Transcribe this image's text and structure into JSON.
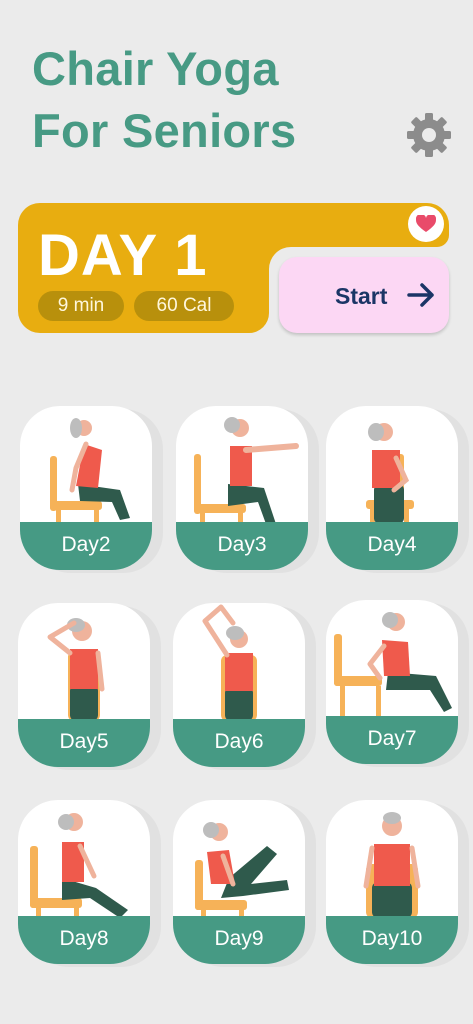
{
  "header": {
    "title_line1": "Chair Yoga",
    "title_line2": "For Seniors"
  },
  "today": {
    "title": "DAY 1",
    "duration": "9 min",
    "calories": "60 Cal",
    "start_label": "Start"
  },
  "days": [
    {
      "label": "Day2"
    },
    {
      "label": "Day3"
    },
    {
      "label": "Day4"
    },
    {
      "label": "Day5"
    },
    {
      "label": "Day6"
    },
    {
      "label": "Day7"
    },
    {
      "label": "Day8"
    },
    {
      "label": "Day9"
    },
    {
      "label": "Day10"
    }
  ],
  "colors": {
    "brand_green": "#479a84",
    "card_yellow": "#e8ad10",
    "pill_dark_yellow": "#b8900c",
    "start_pink": "#fcd7f4",
    "start_text_navy": "#1b3566",
    "heart_red": "#e94b6a",
    "chair_orange": "#f6b258",
    "top_coral": "#ef5a4c",
    "pants_green": "#2f5a4c"
  },
  "icons": {
    "settings": "gear-icon",
    "favorite": "heart-icon",
    "start": "arrow-right-icon"
  }
}
